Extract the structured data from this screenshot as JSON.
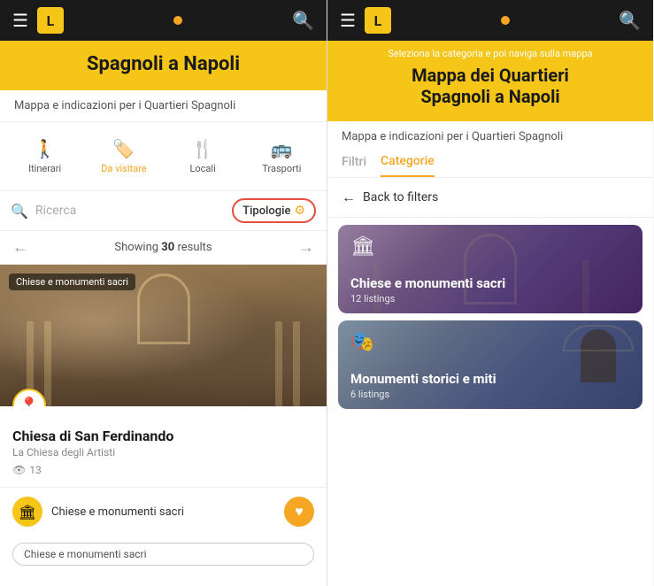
{
  "panels": [
    {
      "id": "panel1",
      "topBar": {
        "hamburger": "☰",
        "logoText": "L",
        "searchSymbol": "🔍"
      },
      "yellowHeader": {
        "title": "Spagnoli a Napoli"
      },
      "descriptionBar": {
        "text": "Mappa e indicazioni per i Quartieri Spagnoli"
      },
      "categoryTabs": [
        {
          "icon": "🚶",
          "label": "Itinerari",
          "active": false
        },
        {
          "icon": "🏷️",
          "label": "Da visitare",
          "active": true
        },
        {
          "icon": "🍴",
          "label": "Locali",
          "active": false
        },
        {
          "icon": "🚌",
          "label": "Trasporti",
          "active": false
        }
      ],
      "searchBar": {
        "placeholder": "Ricerca",
        "filterButton": {
          "label": "Tipologie",
          "icon": "⚙"
        }
      },
      "resultsNav": {
        "showing": "Showing ",
        "count": "30",
        "suffix": " results",
        "prevArrow": "←",
        "nextArrow": "→"
      },
      "card": {
        "badge": "Chiese e monumenti sacri",
        "pinIcon": "📍",
        "title": "Chiesa di San Ferdinando",
        "subtitle": "La Chiesa degli Artisti",
        "viewsIcon": "👁",
        "views": "13"
      },
      "miniCard": {
        "icon": "🏛",
        "label": "Chiese e monumenti sacri",
        "heartIcon": "♥"
      },
      "bottomTag": {
        "label": "Chiese e monumenti sacri"
      }
    },
    {
      "id": "panel2",
      "topBar": {
        "hamburger": "☰",
        "logoText": "L",
        "searchSymbol": "🔍"
      },
      "yellowHeader": {
        "topNote": "Seleziona la categoria e poi naviga sulla mappa",
        "title": "Mappa dei Quartieri\nSpagnoli a Napoli"
      },
      "descriptionBar": {
        "text": "Mappa e indicazioni per i Quartieri Spagnoli"
      },
      "filterTabs": [
        {
          "label": "Filtri",
          "active": false
        },
        {
          "label": "Categorie",
          "active": true
        }
      ],
      "backButton": {
        "arrow": "←",
        "label": "Back to filters"
      },
      "categoryCards": [
        {
          "icon": "🏛",
          "title": "Chiese e monumenti sacri",
          "count": "12 listings",
          "colorClass": "cat-card-bg-1"
        },
        {
          "icon": "🎭",
          "title": "Monumenti storici e miti",
          "count": "6 listings",
          "colorClass": "cat-card-bg-2"
        }
      ]
    }
  ],
  "colors": {
    "yellow": "#f5c518",
    "orange": "#f5a623",
    "dark": "#1a1a1a",
    "red": "#e74c3c"
  }
}
